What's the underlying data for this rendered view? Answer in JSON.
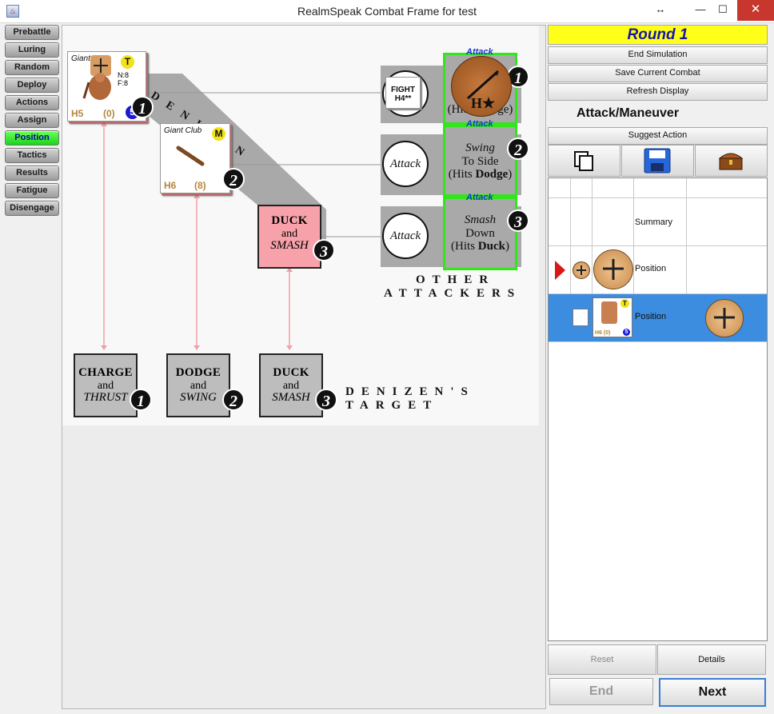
{
  "window": {
    "title": "RealmSpeak Combat Frame for test",
    "controls": {
      "resize": "↔",
      "minimize": "—",
      "maximize": "☐",
      "close": "✕"
    }
  },
  "phases": [
    {
      "label": "Prebattle",
      "active": false
    },
    {
      "label": "Luring",
      "active": false
    },
    {
      "label": "Random",
      "active": false
    },
    {
      "label": "Deploy",
      "active": false
    },
    {
      "label": "Actions",
      "active": false
    },
    {
      "label": "Assign",
      "active": false
    },
    {
      "label": "Position",
      "active": true
    },
    {
      "label": "Tactics",
      "active": false
    },
    {
      "label": "Results",
      "active": false
    },
    {
      "label": "Fatigue",
      "active": false
    },
    {
      "label": "Disengage",
      "active": false
    }
  ],
  "sheet": {
    "denizen_label": "DENIZEN",
    "other_attackers": [
      "OTHER",
      "ATTACKERS"
    ],
    "denizens_target": [
      "DENIZEN'S",
      "TARGET"
    ],
    "giant": {
      "name": "Giant",
      "badge": "T",
      "stats_n": "N:8",
      "stats_f": "F:8",
      "harm": "H5",
      "fame": "(0)",
      "speed": "5",
      "slot": "1"
    },
    "giant_club": {
      "name": "Giant Club",
      "badge": "M",
      "harm": "H6",
      "fame": "(8)",
      "slot": "2"
    },
    "duck_smash_red": {
      "l1": "DUCK",
      "l2": "and",
      "l3": "SMASH",
      "num": "3"
    },
    "fight_chit": {
      "l1": "FIGHT",
      "l2": "H4**"
    },
    "attack_circles": [
      "Attack",
      "Attack"
    ],
    "attack_labels": [
      "Attack",
      "Attack",
      "Attack"
    ],
    "green_cells": [
      {
        "t1": "",
        "t2": "(Hits Charge)",
        "num": "1"
      },
      {
        "t1": "Swing",
        "t2a": "To Side",
        "t2b": "(Hits ",
        "bold": "Dodge",
        "t2c": ")",
        "num": "2"
      },
      {
        "t1": "Smash",
        "t2a": "Down",
        "t2b": "(Hits ",
        "bold": "Duck",
        "t2c": ")",
        "num": "3"
      }
    ],
    "target_boxes": [
      {
        "l1": "CHARGE",
        "l2": "and",
        "l3": "THRUST",
        "num": "1"
      },
      {
        "l1": "DODGE",
        "l2": "and",
        "l3": "SWING",
        "num": "2"
      },
      {
        "l1": "DUCK",
        "l2": "and",
        "l3": "SMASH",
        "num": "3"
      }
    ]
  },
  "right_panel": {
    "round": "Round 1",
    "buttons": [
      "End Simulation",
      "Save Current Combat",
      "Refresh Display"
    ],
    "mode_label": "Attack/Maneuver",
    "suggest": "Suggest Action",
    "icon_buttons": [
      "copy-icon",
      "save-icon",
      "treasure-chest-icon"
    ],
    "rows": [
      {
        "label": "Summary"
      },
      {
        "label": "Position"
      },
      {
        "label": "Position"
      }
    ],
    "mini_counter": {
      "harm": "H6",
      "fame": "(0)",
      "speed": "5",
      "badge": "T"
    },
    "reset": "Reset",
    "details": "Details",
    "end": "End",
    "next": "Next"
  }
}
